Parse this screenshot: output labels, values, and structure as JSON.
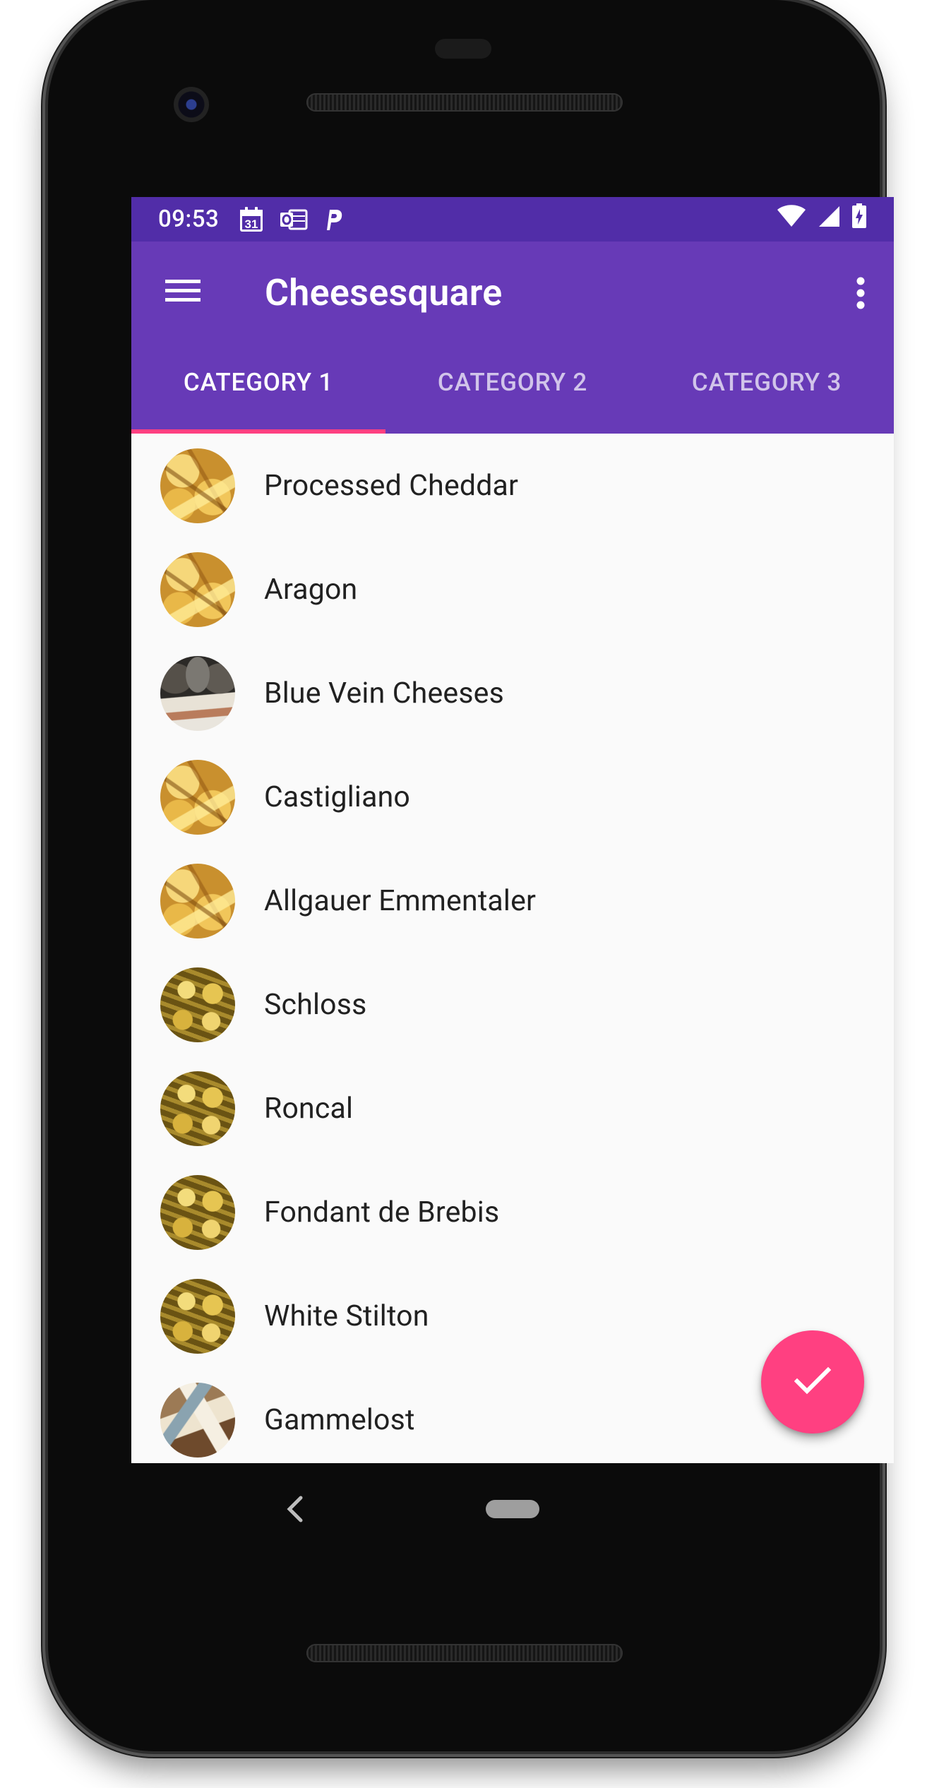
{
  "status_bar": {
    "time": "09:53",
    "calendar_day": "31",
    "icons": [
      "calendar-icon",
      "outlook-icon",
      "parking-icon",
      "wifi-icon",
      "cell-signal-icon",
      "battery-icon"
    ]
  },
  "toolbar": {
    "title": "Cheesesquare",
    "menu_icon": "hamburger-menu-icon",
    "overflow_icon": "more-vert-icon"
  },
  "tabs": [
    {
      "label": "CATEGORY 1",
      "active": true
    },
    {
      "label": "CATEGORY 2",
      "active": false
    },
    {
      "label": "CATEGORY 3",
      "active": false
    }
  ],
  "cheeses": [
    {
      "name": "Processed Cheddar",
      "image": "cheddar"
    },
    {
      "name": "Aragon",
      "image": "cheddar"
    },
    {
      "name": "Blue Vein Cheeses",
      "image": "blue"
    },
    {
      "name": "Castigliano",
      "image": "cheddar"
    },
    {
      "name": "Allgauer Emmentaler",
      "image": "cheddar"
    },
    {
      "name": "Schloss",
      "image": "wheels"
    },
    {
      "name": "Roncal",
      "image": "wheels"
    },
    {
      "name": "Fondant de Brebis",
      "image": "wheels"
    },
    {
      "name": "White Stilton",
      "image": "wheels"
    },
    {
      "name": "Gammelost",
      "image": "gammel"
    }
  ],
  "fab": {
    "icon": "check-icon"
  },
  "colors": {
    "primary": "#673ab7",
    "primary_dark": "#512da8",
    "accent": "#ff4081",
    "background": "#fafafa"
  }
}
